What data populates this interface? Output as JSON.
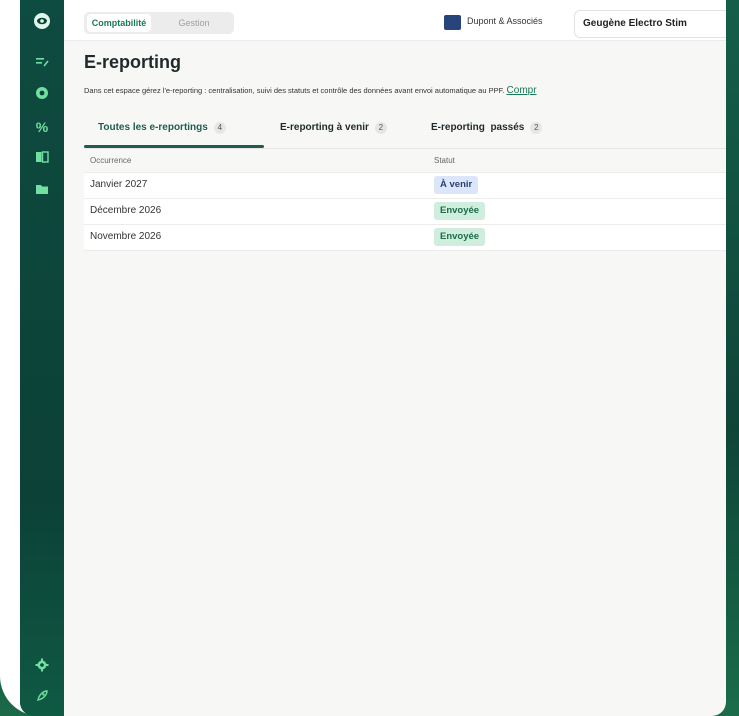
{
  "app": {
    "mode_switch": {
      "active": "Comptabilité",
      "inactive": "Gestion"
    },
    "company": "Dupont & Associés",
    "client": "Geugène Electro Stim"
  },
  "sidebar": {
    "top_icons": [
      "eye-icon",
      "list-edit-icon",
      "circle-icon",
      "percent-icon",
      "book-icon",
      "folder-icon"
    ],
    "bottom_icons": [
      "gear-icon",
      "rocket-icon"
    ]
  },
  "page": {
    "title": "E-reporting",
    "description": "Dans cet espace gérez l'e-reporting : centralisation, suivi des statuts et contrôle des données avant envoi automatique au PPF.",
    "description_link": "Compr"
  },
  "tabs": [
    {
      "label": "Toutes les e-reportings",
      "count": "4"
    },
    {
      "label": "E-reporting à venir",
      "count": "2"
    },
    {
      "label": "E-reporting  passés",
      "count": "2"
    }
  ],
  "table": {
    "headers": {
      "occurrence": "Occurrence",
      "status": "Statut"
    },
    "rows": [
      {
        "occurrence": "Janvier 2027",
        "status": "À venir",
        "status_color": "#dbe6fb"
      },
      {
        "occurrence": "Décembre 2026",
        "status": "Envoyée",
        "status_color": "#cfeedd"
      },
      {
        "occurrence": "Novembre 2026",
        "status": "Envoyée",
        "status_color": "#cfeedd"
      }
    ]
  },
  "colors": {
    "brand_green": "#167a57",
    "sidebar_bg": "#0d4239",
    "accent_edge": "#2bd26a"
  }
}
